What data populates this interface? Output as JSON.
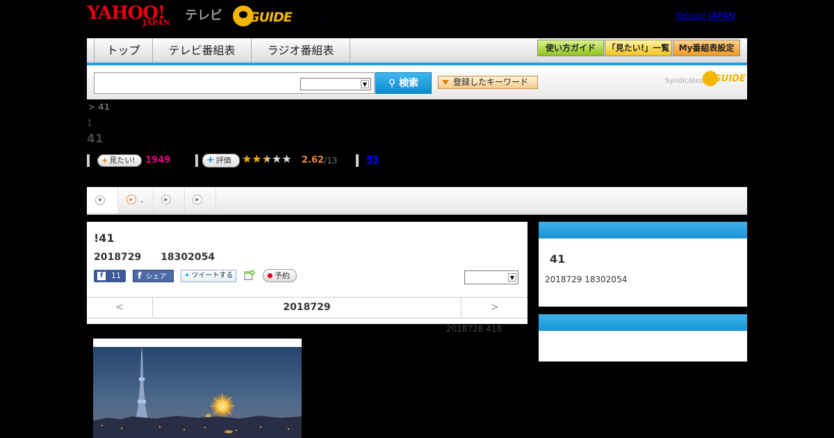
{
  "header": {
    "logo_yahoo": "YAHOO!",
    "logo_japan": "JAPAN",
    "logo_tv": "テレビ",
    "logo_guide": "GUIDE",
    "yahoo_japan_link": "Yahoo! JAPAN",
    "dot": "."
  },
  "nav": {
    "tabs": [
      "トップ",
      "テレビ番組表",
      "ラジオ番組表"
    ],
    "buttons": [
      "使い方ガイド",
      "「見たい!」一覧",
      "My番組表設定"
    ],
    "accent": "#1ba1de"
  },
  "search": {
    "input_value": "",
    "select_value": "",
    "button_label": "検索",
    "keyword_button": "登録したキーワード",
    "syndicated_label": "Syndicated",
    "syndicated_guide": "GUIDE"
  },
  "program": {
    "breadcrumb": "> 41",
    "episode_line": "1",
    "title_line": "41",
    "mitai_label": "見たい!",
    "mitai_count": "1949",
    "rating_label": "評価",
    "rating_value": "2.62",
    "rating_count": "/13",
    "review_count": "53",
    "rating_stars": 2.5
  },
  "tabs": {
    "items": [
      "",
      ".",
      "",
      ""
    ]
  },
  "main": {
    "title": "!41",
    "date_line": "2018729　　18302054",
    "fb_count": "11",
    "fb_share": "シェア",
    "tweet_label": "ツイートする",
    "reserve_label": "予約",
    "select_value": "",
    "prev_label": "<",
    "day_label": "2018729",
    "next_label": ">",
    "air_info": "2018728  418"
  },
  "side": {
    "panel1_title": "41",
    "panel1_date": "2018729  18302054"
  }
}
